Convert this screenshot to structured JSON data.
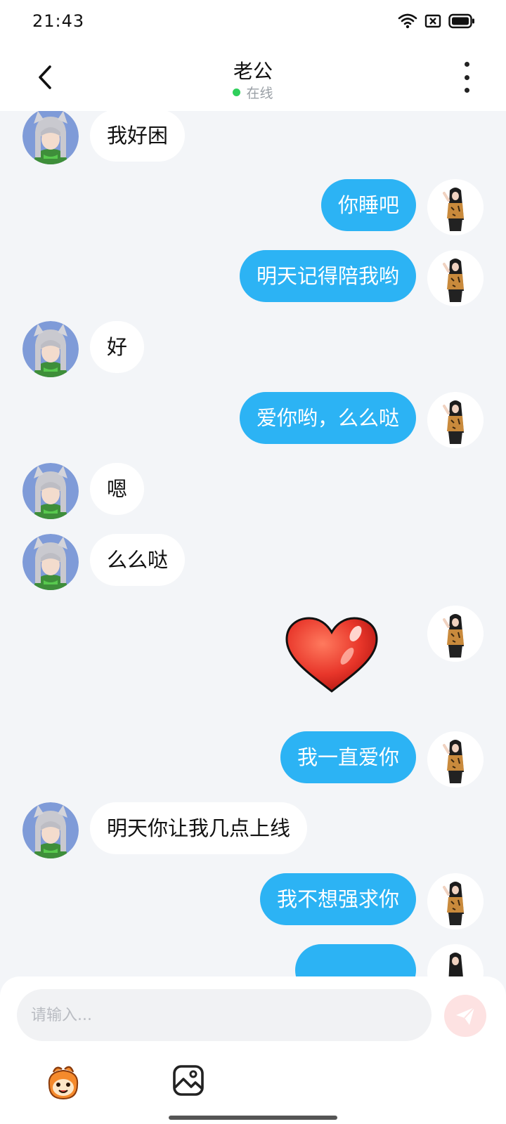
{
  "status_bar": {
    "time": "21:43"
  },
  "header": {
    "title": "老公",
    "status": "在线"
  },
  "messages": [
    {
      "side": "left",
      "text": "我好困"
    },
    {
      "side": "right",
      "text": "你睡吧"
    },
    {
      "side": "right",
      "text": "明天记得陪我哟"
    },
    {
      "side": "left",
      "text": "好"
    },
    {
      "side": "right",
      "text": "爱你哟，么么哒"
    },
    {
      "side": "left",
      "text": "嗯"
    },
    {
      "side": "left",
      "text": "么么哒"
    },
    {
      "side": "right",
      "sticker": "heart-sticker"
    },
    {
      "side": "right",
      "text": "我一直爱你"
    },
    {
      "side": "left",
      "text": "明天你让我几点上线"
    },
    {
      "side": "right",
      "text": "我不想强求你"
    },
    {
      "side": "right",
      "text": ""
    }
  ],
  "composer": {
    "placeholder": "请输入..."
  },
  "colors": {
    "outgoing_bubble": "#2cb3f4",
    "incoming_bubble": "#ffffff",
    "online": "#2fcf5b",
    "send_button": "#fde2e2"
  }
}
